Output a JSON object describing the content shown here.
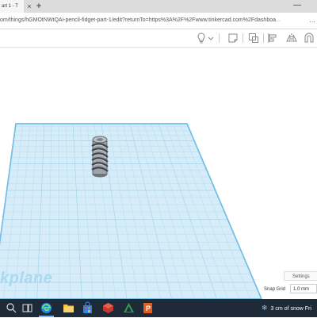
{
  "browser": {
    "tab_title": "art 1 - T",
    "close_glyph": "×",
    "new_tab_glyph": "+",
    "minimize_glyph": "—",
    "url_main": "om/things/hGMOtNWtQAi-pencil-fidget-part-1/edit?returnTo=https%3A%2F%2Fwww.tinkercad.com%2Fdashboa",
    "url_tail": "...",
    "addr_more_glyph": "…"
  },
  "toolbar": {
    "icons": [
      "lightbulb-icon",
      "note-icon",
      "group-icon",
      "align-icon",
      "mirror-icon",
      "magnet-icon"
    ]
  },
  "workspace": {
    "workplane_label": "kplane",
    "settings_label": "Settings",
    "snap_grid_label": "Snap Grid",
    "snap_grid_value": "1.0 mm"
  },
  "taskbar": {
    "weather_text": "3 cm of snow Fri",
    "weather_icon": "snowflake-icon",
    "weather_glyph": "❄",
    "apps": [
      "task-view-icon",
      "edge-icon",
      "file-explorer-icon",
      "store-icon",
      "sketchup-icon",
      "powerpoint-icon"
    ]
  },
  "colors": {
    "workplane_fill": "#cfe9f7",
    "workplane_border": "#6fbde6",
    "grid_line": "#b7dcef",
    "model": "#8a9096",
    "taskbar": "#1f2a38"
  }
}
